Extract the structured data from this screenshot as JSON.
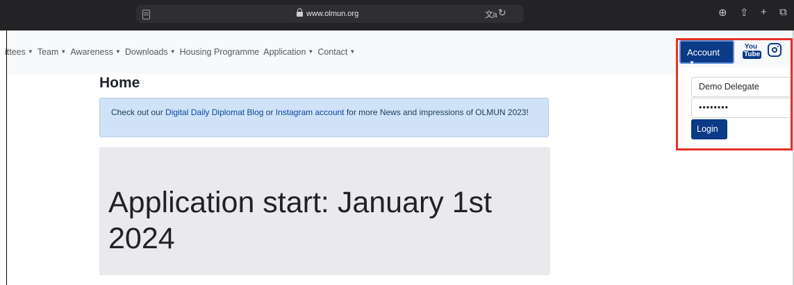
{
  "browser": {
    "url": "www.olmun.org",
    "icons": [
      "sidebar-icon",
      "lock-icon",
      "translate-icon",
      "reload-icon",
      "download-icon",
      "share-icon",
      "new-tab-icon",
      "tabs-overview-icon"
    ],
    "translate_glyph": "⽂a",
    "reload_glyph": "↻",
    "download_glyph": "⊕",
    "share_glyph": "⇧",
    "plus_glyph": "+",
    "tabs_glyph": "⧉"
  },
  "nav": {
    "items": [
      {
        "label": "ittees",
        "caret": "▼"
      },
      {
        "label": "Team",
        "caret": "▼"
      },
      {
        "label": "Awareness",
        "caret": "▼"
      },
      {
        "label": "Downloads",
        "caret": "▼"
      },
      {
        "label": "Housing Programme",
        "caret": ""
      },
      {
        "label": "Application",
        "caret": "▼"
      },
      {
        "label": "Contact",
        "caret": "▼"
      }
    ]
  },
  "account": {
    "button_label": "Account",
    "caret": "▼",
    "youtube_top": "You",
    "youtube_bottom": "Tube",
    "username_value": "Demo Delegate",
    "password_value": "••••••••",
    "login_label": "Login",
    "highlight_color": "#e53027"
  },
  "main": {
    "title": "Home",
    "alert": {
      "prefix": "Check out our ",
      "link1": "Digital Daily Diplomat Blog",
      "middle": " or ",
      "link2": "Instagram account",
      "suffix": " for more News and impressions of OLMUN 2023!"
    },
    "jumbotron_heading": "Application start: January 1st 2024"
  },
  "colors": {
    "brand": "#0b3a86",
    "alert_bg": "#cfe2f7",
    "jumbotron_bg": "#e9e9ee"
  }
}
